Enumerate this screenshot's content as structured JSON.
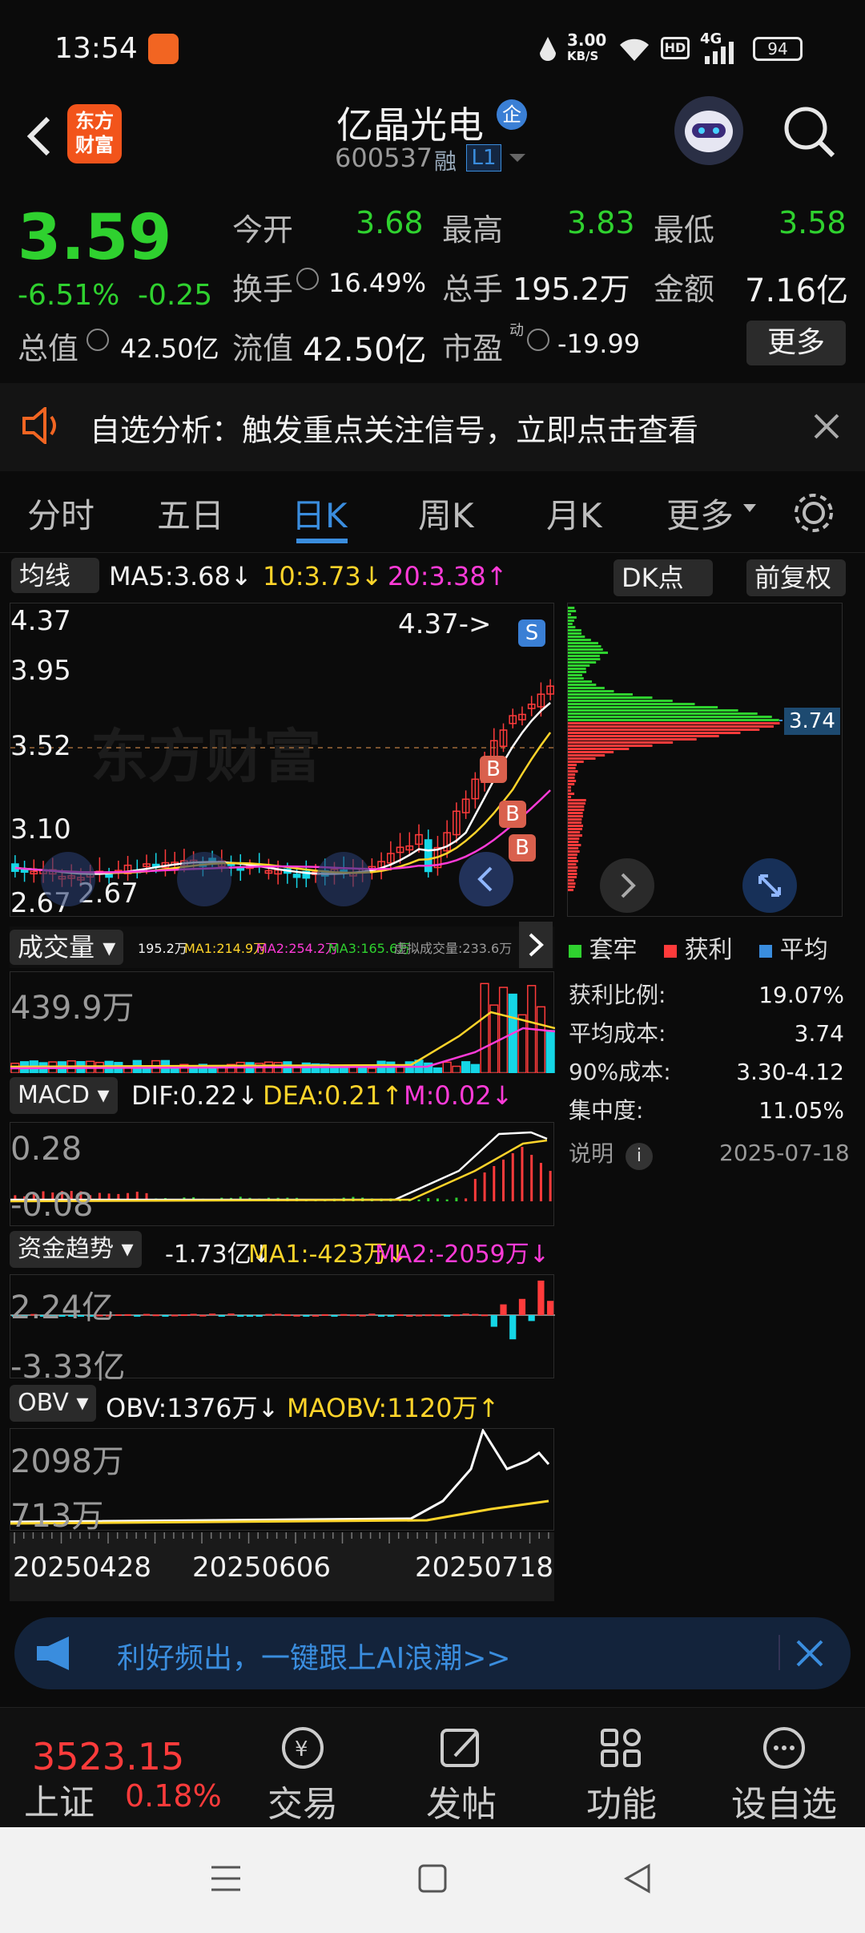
{
  "status_bar": {
    "time": "13:54",
    "net_speed_top": "3.00",
    "net_speed_bottom": "KB/S",
    "hd": "HD",
    "signal": "4G",
    "battery": "94"
  },
  "header": {
    "logo_line1": "东方",
    "logo_line2": "财富",
    "stock_name": "亿晶光电",
    "corp_badge": "企",
    "code": "600537",
    "margin_tag": "融",
    "level_tag": "L1"
  },
  "quote": {
    "price": "3.59",
    "change_pct": "-6.51%",
    "change": "-0.25",
    "open_label": "今开",
    "open": "3.68",
    "high_label": "最高",
    "high": "3.83",
    "low_label": "最低",
    "low": "3.58",
    "turnover_label": "换手",
    "turnover": "16.49%",
    "volume_label": "总手",
    "volume": "195.2万",
    "amount_label": "金额",
    "amount": "7.16亿",
    "mktcap_label": "总值",
    "mktcap": "42.50亿",
    "float_label": "流值",
    "float": "42.50亿",
    "pe_label": "市盈",
    "pe_sup": "动",
    "pe": "-19.99",
    "more_button": "更多"
  },
  "banner": {
    "text": "自选分析：触发重点关注信号，立即点击查看"
  },
  "tabs": [
    "分时",
    "五日",
    "日K",
    "周K",
    "月K",
    "更多"
  ],
  "active_tab": "日K",
  "kline": {
    "ma_select": "均线",
    "ma5": "MA5:3.68",
    "ma10": "10:3.73",
    "ma20": "20:3.38",
    "dk_button": "DK点",
    "adjust_button": "前复权",
    "y_ticks": [
      "4.37",
      "3.95",
      "3.52",
      "3.10",
      "2.67"
    ],
    "high_annotation": "4.37->",
    "low_annotation": "2.67",
    "s_marker": "S",
    "b_marker": "B",
    "watermark": "东方财富"
  },
  "chip_dist": {
    "cost_label": "3.74",
    "legend": [
      "套牢",
      "获利",
      "平均"
    ],
    "rows": [
      {
        "label": "获利比例:",
        "value": "19.07%"
      },
      {
        "label": "平均成本:",
        "value": "3.74"
      },
      {
        "label": "90%成本:",
        "value": "3.30-4.12"
      },
      {
        "label": "集中度:",
        "value": "11.05%"
      }
    ],
    "explain": "说明",
    "date": "2025-07-18"
  },
  "volume": {
    "select": "成交量",
    "vol": "195.2万",
    "ma1": "MA1:214.9万",
    "ma2": "MA2:254.2万",
    "ma3": "MA3:165.6万",
    "virtual": "虚拟成交量:233.6万",
    "y_top": "439.9万"
  },
  "macd": {
    "select": "MACD",
    "dif": "DIF:0.22",
    "dea": "DEA:0.21",
    "m": "M:0.02",
    "y_top": "0.28",
    "y_bottom": "-0.08"
  },
  "fund": {
    "select": "资金趋势",
    "value": "-1.73亿",
    "ma1": "MA1:-423万",
    "ma2": "MA2:-2059万",
    "y_top": "2.24亿",
    "y_bottom": "-3.33亿"
  },
  "obv": {
    "select": "OBV",
    "obv": "OBV:1376万",
    "maobv": "MAOBV:1120万",
    "y_top": "2098万",
    "y_bottom": "713万"
  },
  "x_dates": [
    "20250428",
    "20250606",
    "20250718"
  ],
  "ad_bar": {
    "text": "利好频出，一键跟上AI浪潮>>"
  },
  "bottom_nav": {
    "index_value": "3523.15",
    "index_name": "上证",
    "index_change": "0.18%",
    "items": [
      "交易",
      "发帖",
      "功能",
      "设自选"
    ]
  },
  "colors": {
    "up": "#ff3b3b",
    "down": "#2fd12f",
    "accent": "#3a8dde",
    "yellow": "#ffd42a",
    "magenta": "#ff3bd8",
    "cyan": "#15d6e6"
  }
}
